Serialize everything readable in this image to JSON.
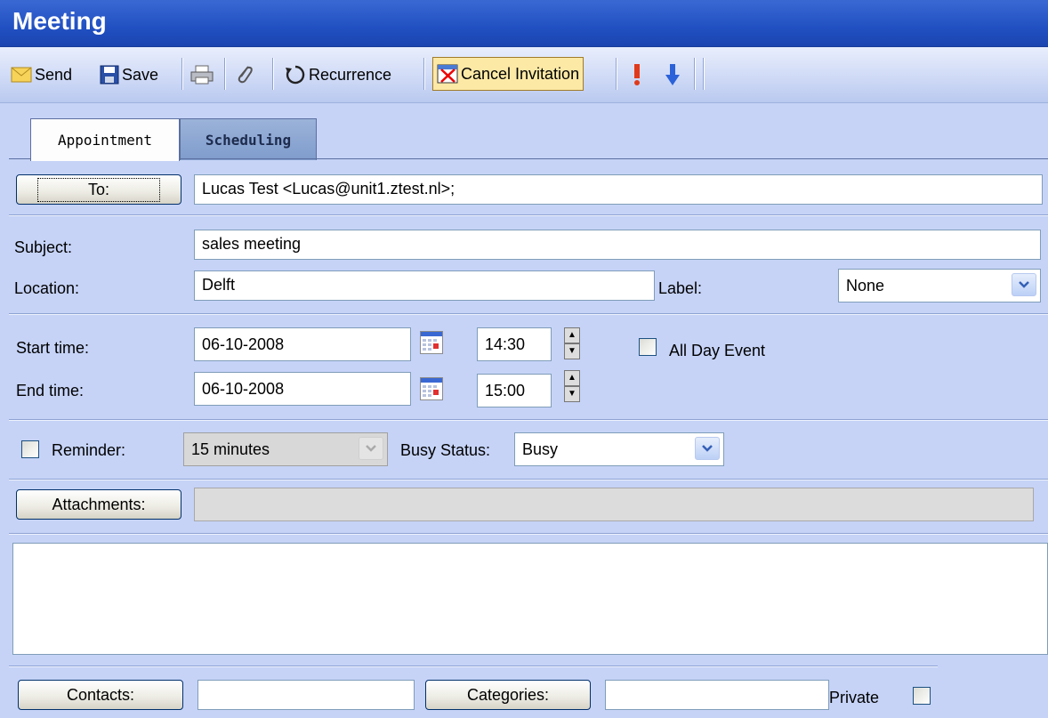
{
  "window": {
    "title": "Meeting"
  },
  "toolbar": {
    "send": "Send",
    "save": "Save",
    "recurrence": "Recurrence",
    "cancel_invitation": "Cancel Invitation"
  },
  "tabs": [
    {
      "label": "Appointment",
      "active": true
    },
    {
      "label": "Scheduling",
      "active": false
    }
  ],
  "form": {
    "to_button": "To:",
    "to_value": "Lucas Test <Lucas@unit1.ztest.nl>;",
    "subject_label": "Subject:",
    "subject_value": "sales meeting",
    "location_label": "Location:",
    "location_value": "Delft",
    "label_label": "Label:",
    "label_value": "None",
    "start_label": "Start time:",
    "start_date": "06-10-2008",
    "start_time": "14:30",
    "end_label": "End time:",
    "end_date": "06-10-2008",
    "end_time": "15:00",
    "all_day_label": "All Day Event",
    "reminder_label": "Reminder:",
    "reminder_value": "15 minutes",
    "busy_label": "Busy Status:",
    "busy_value": "Busy",
    "attachments_button": "Attachments:",
    "attachments_value": "",
    "notes": ""
  },
  "footer": {
    "contacts_button": "Contacts:",
    "contacts_value": "",
    "categories_button": "Categories:",
    "categories_value": "",
    "private_label": "Private"
  },
  "colors": {
    "title_bar": "#2150c2",
    "background": "#c6d3f7",
    "highlight_button": "#fde9a6"
  }
}
